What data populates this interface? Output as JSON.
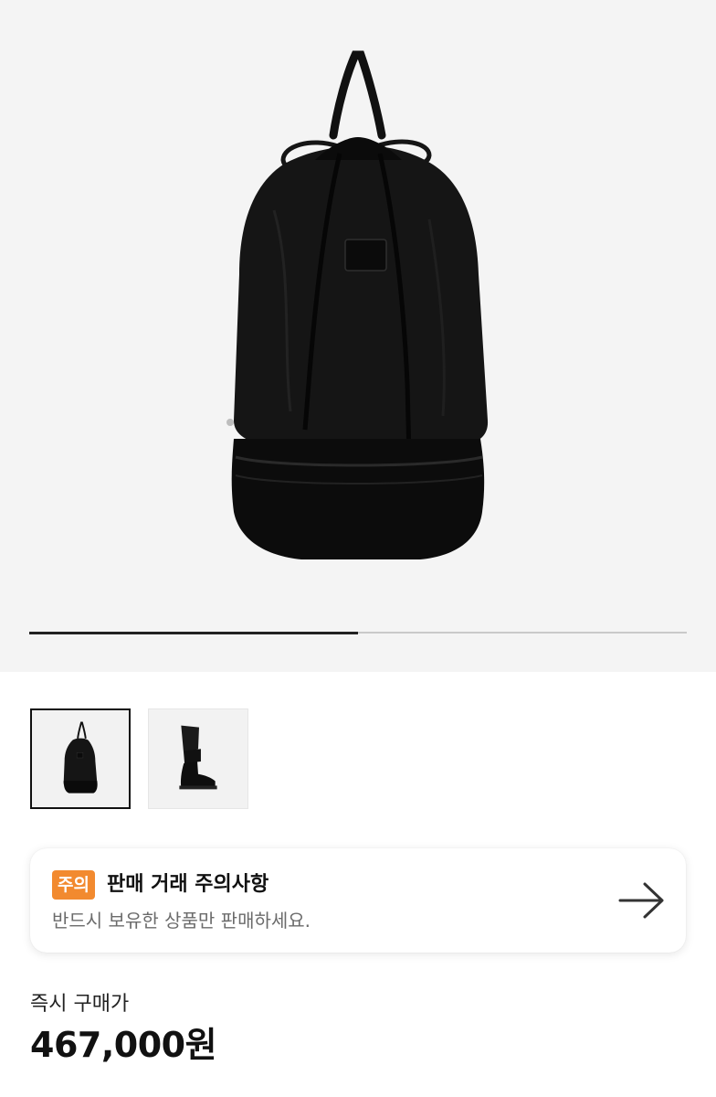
{
  "gallery": {
    "current_image": 1,
    "total_images": 2,
    "progress_fraction": 0.5,
    "thumbnails": [
      {
        "subject": "black drawstring backpack",
        "selected": true
      },
      {
        "subject": "black rubber boot with folded leg",
        "selected": false
      }
    ]
  },
  "notice": {
    "badge": "주의",
    "title": "판매 거래 주의사항",
    "description": "반드시 보유한 상품만 판매하세요.",
    "arrow_icon": "arrow-right-icon"
  },
  "price": {
    "label": "즉시 구매가",
    "value": "467,000원"
  },
  "colors": {
    "badge": "#f28a2f",
    "hero_background": "#f4f4f4"
  }
}
